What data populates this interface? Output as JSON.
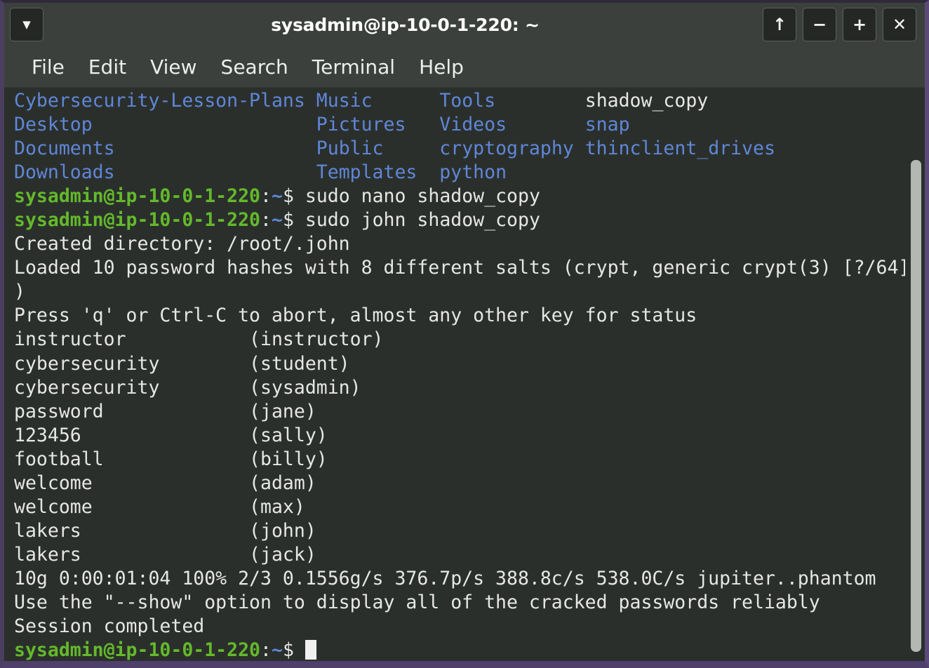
{
  "window": {
    "title": "sysadmin@ip-10-0-1-220: ~",
    "menu_button_icon": "chevron-down-icon",
    "controls": [
      {
        "name": "shade-button",
        "icon": "up-arrow-icon",
        "glyph": "↑"
      },
      {
        "name": "minimize-button",
        "icon": "minus-icon",
        "glyph": "−"
      },
      {
        "name": "maximize-button",
        "icon": "plus-icon",
        "glyph": "+"
      },
      {
        "name": "close-button",
        "icon": "close-icon",
        "glyph": "✕"
      }
    ],
    "caret_glyph": "▼"
  },
  "menubar": {
    "items": [
      "File",
      "Edit",
      "View",
      "Search",
      "Terminal",
      "Help"
    ]
  },
  "colors": {
    "titlebar_bg": "#3b403c",
    "terminal_bg": "#2b2f2c",
    "directory_blue": "#5f87d7",
    "prompt_green": "#63b92b",
    "foreground": "#d6d6d6",
    "border_purple": "#4e3f6b",
    "scrollbar_thumb": "#b4b8b2"
  },
  "terminal": {
    "prompt": {
      "user_host": "sysadmin@ip-10-0-1-220",
      "colon": ":",
      "path": "~",
      "sigil": "$"
    },
    "listing": {
      "rows": [
        [
          {
            "text": "Cybersecurity-Lesson-Plans",
            "type": "dir"
          },
          {
            "text": "Music",
            "type": "dir"
          },
          {
            "text": "Tools",
            "type": "dir"
          },
          {
            "text": "shadow_copy",
            "type": "file"
          }
        ],
        [
          {
            "text": "Desktop",
            "type": "dir"
          },
          {
            "text": "Pictures",
            "type": "dir"
          },
          {
            "text": "Videos",
            "type": "dir"
          },
          {
            "text": "snap",
            "type": "dir"
          }
        ],
        [
          {
            "text": "Documents",
            "type": "dir"
          },
          {
            "text": "Public",
            "type": "dir"
          },
          {
            "text": "cryptography",
            "type": "dir"
          },
          {
            "text": "thinclient_drives",
            "type": "dir"
          }
        ],
        [
          {
            "text": "Downloads",
            "type": "dir"
          },
          {
            "text": "Templates",
            "type": "dir"
          },
          {
            "text": "python",
            "type": "dir"
          },
          {
            "text": "",
            "type": "dir"
          }
        ]
      ]
    },
    "commands": {
      "first": "sudo nano shadow_copy",
      "second": "sudo john shadow_copy"
    },
    "john_output": {
      "created_directory": "Created directory: /root/.john",
      "loaded_line_part1": "Loaded 10 password hashes with 8 different salts (crypt, generic crypt(3) [?/64]",
      "loaded_line_part2": ")",
      "abort_hint": "Press 'q' or Ctrl-C to abort, almost any other key for status",
      "cracked": [
        {
          "password": "instructor",
          "user": "instructor"
        },
        {
          "password": "cybersecurity",
          "user": "student"
        },
        {
          "password": "cybersecurity",
          "user": "sysadmin"
        },
        {
          "password": "password",
          "user": "jane"
        },
        {
          "password": "123456",
          "user": "sally"
        },
        {
          "password": "football",
          "user": "billy"
        },
        {
          "password": "welcome",
          "user": "adam"
        },
        {
          "password": "welcome",
          "user": "max"
        },
        {
          "password": "lakers",
          "user": "john"
        },
        {
          "password": "lakers",
          "user": "jack"
        }
      ],
      "status_line": {
        "guesses": "10g",
        "elapsed": "0:00:01:04",
        "percent": "100%",
        "stage": "2/3",
        "gps": "0.1556g/s",
        "pps": "376.7p/s",
        "cps": "388.8c/s",
        "big_cps": "538.0C/s",
        "candidates": "jupiter..phantom",
        "full": "10g 0:00:01:04 100% 2/3 0.1556g/s 376.7p/s 388.8c/s 538.0C/s jupiter..phantom"
      },
      "show_hint": "Use the \"--show\" option to display all of the cracked passwords reliably",
      "session": "Session completed"
    }
  }
}
